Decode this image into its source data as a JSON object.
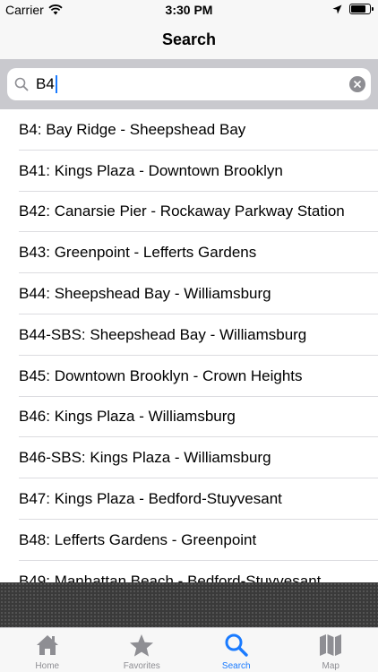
{
  "status_bar": {
    "carrier": "Carrier",
    "time": "3:30 PM"
  },
  "nav": {
    "title": "Search"
  },
  "search": {
    "value": "B4"
  },
  "routes": [
    "B4: Bay Ridge - Sheepshead Bay",
    "B41: Kings Plaza - Downtown Brooklyn",
    "B42: Canarsie Pier - Rockaway Parkway Station",
    "B43: Greenpoint - Lefferts Gardens",
    "B44: Sheepshead Bay - Williamsburg",
    "B44-SBS: Sheepshead Bay - Williamsburg",
    "B45: Downtown Brooklyn - Crown Heights",
    "B46: Kings Plaza - Williamsburg",
    "B46-SBS: Kings Plaza - Williamsburg",
    "B47: Kings Plaza - Bedford-Stuyvesant",
    "B48: Lefferts Gardens - Greenpoint",
    "B49: Manhattan Beach - Bedford-Stuyvesant"
  ],
  "tabs": [
    {
      "label": "Home",
      "icon": "home-icon"
    },
    {
      "label": "Favorites",
      "icon": "star-icon"
    },
    {
      "label": "Search",
      "icon": "search-icon"
    },
    {
      "label": "Map",
      "icon": "map-icon"
    }
  ],
  "colors": {
    "accent": "#1a7bff",
    "inactive": "#8e8e93"
  }
}
